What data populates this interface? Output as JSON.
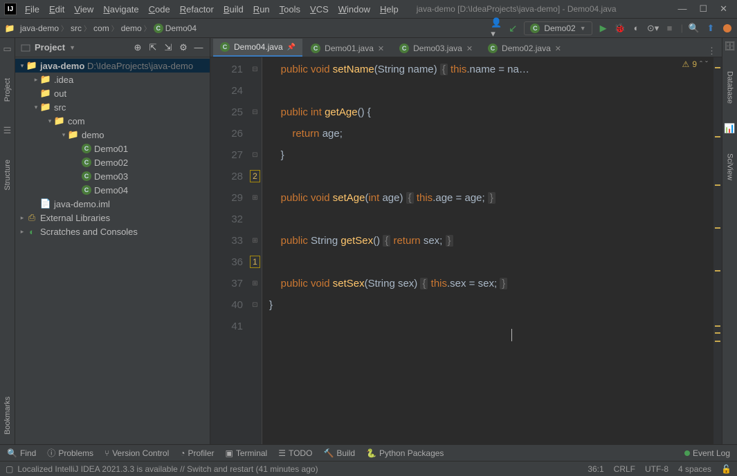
{
  "title": "java-demo [D:\\IdeaProjects\\java-demo] - Demo04.java",
  "menu": [
    "File",
    "Edit",
    "View",
    "Navigate",
    "Code",
    "Refactor",
    "Build",
    "Run",
    "Tools",
    "VCS",
    "Window",
    "Help"
  ],
  "breadcrumb": [
    "java-demo",
    "src",
    "com",
    "demo",
    "Demo04"
  ],
  "run_config": "Demo02",
  "left_tabs": {
    "project": "Project",
    "structure": "Structure",
    "bookmarks": "Bookmarks"
  },
  "right_tabs": {
    "database": "Database",
    "sciview": "SciView"
  },
  "project_panel_title": "Project",
  "tree": {
    "root_name": "java-demo",
    "root_path": "D:\\IdeaProjects\\java-demo",
    "idea": ".idea",
    "out": "out",
    "src": "src",
    "com": "com",
    "demo": "demo",
    "classes": [
      "Demo01",
      "Demo02",
      "Demo03",
      "Demo04"
    ],
    "iml": "java-demo.iml",
    "ext_lib": "External Libraries",
    "scratches": "Scratches and Consoles"
  },
  "tabs": [
    {
      "label": "Demo04.java",
      "active": true,
      "pinned": true
    },
    {
      "label": "Demo01.java",
      "active": false
    },
    {
      "label": "Demo03.java",
      "active": false
    },
    {
      "label": "Demo02.java",
      "active": false
    }
  ],
  "warn_count": "9",
  "gutter_lines": [
    "21",
    "24",
    "25",
    "26",
    "27",
    "28",
    "29",
    "32",
    "33",
    "36",
    "37",
    "40",
    "41"
  ],
  "code_lines": [
    {
      "html": "    <span class='kw'>public</span> <span class='kw'>void</span> <span class='fn'>setName</span>(String name) <span class='hint'>{</span> <span class='kw'>this</span>.name = na…"
    },
    {
      "html": ""
    },
    {
      "html": "    <span class='kw'>public</span> <span class='kw'>int</span> <span class='fn'>getAge</span>() {"
    },
    {
      "html": "        <span class='kw'>return</span> age;"
    },
    {
      "html": "    }"
    },
    {
      "html": "",
      "ind": "2"
    },
    {
      "html": "    <span class='kw'>public</span> <span class='kw'>void</span> <span class='fn'>setAge</span>(<span class='kw'>int</span> age) <span class='hint'>{</span> <span class='kw'>this</span>.age = age; <span class='hint'>}</span>"
    },
    {
      "html": ""
    },
    {
      "html": "    <span class='kw'>public</span> String <span class='fn'>getSex</span>() <span class='hint'>{</span> <span class='kw'>return</span> sex; <span class='hint'>}</span>"
    },
    {
      "html": "",
      "ind": "1"
    },
    {
      "html": "    <span class='kw'>public</span> <span class='kw'>void</span> <span class='fn'>setSex</span>(String sex) <span class='hint'>{</span> <span class='kw'>this</span>.sex = sex; <span class='hint'>}</span>"
    },
    {
      "html": "}"
    },
    {
      "html": ""
    }
  ],
  "bottom_tools": {
    "find": "Find",
    "problems": "Problems",
    "vcs": "Version Control",
    "profiler": "Profiler",
    "terminal": "Terminal",
    "todo": "TODO",
    "build": "Build",
    "python": "Python Packages",
    "event_log": "Event Log"
  },
  "status_msg": "Localized IntelliJ IDEA 2021.3.3 is available // Switch and restart (41 minutes ago)",
  "status_right": {
    "pos": "36:1",
    "eol": "CRLF",
    "enc": "UTF-8",
    "indent": "4 spaces"
  }
}
